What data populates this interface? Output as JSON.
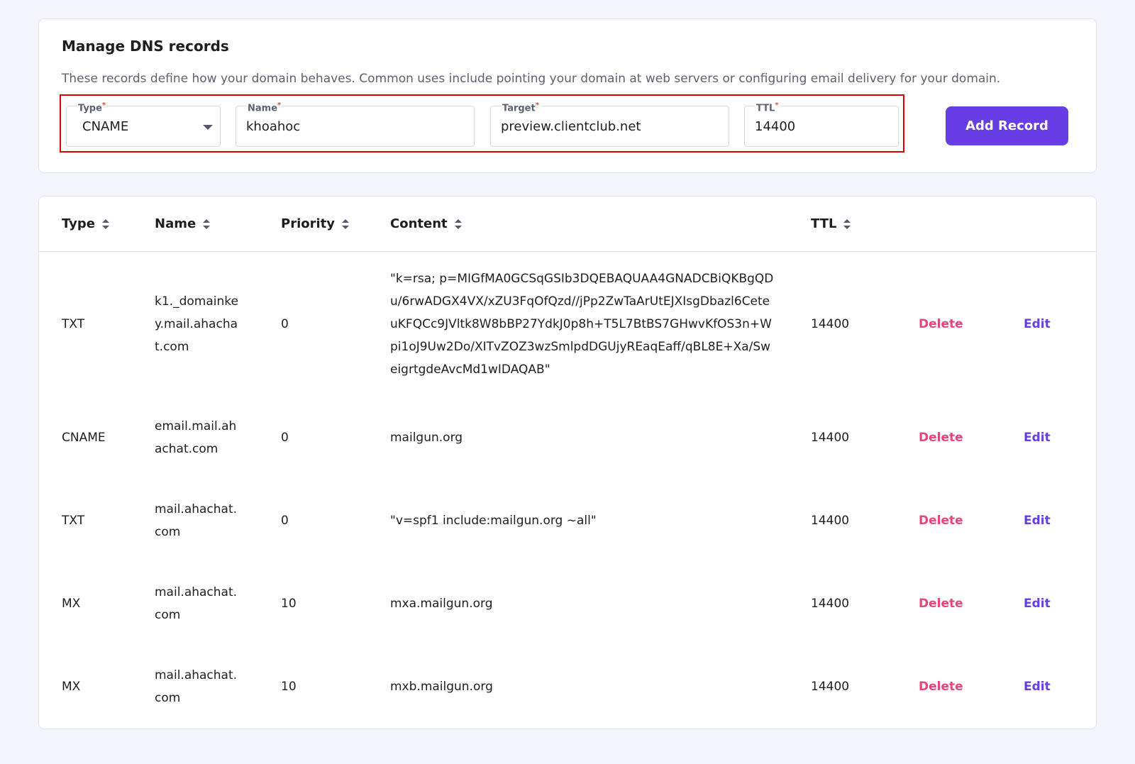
{
  "manage": {
    "title": "Manage DNS records",
    "description": "These records define how your domain behaves. Common uses include pointing your domain at web servers or configuring email delivery for your domain.",
    "form": {
      "type_label": "Type",
      "type_value": "CNAME",
      "name_label": "Name",
      "name_value": "khoahoc",
      "target_label": "Target",
      "target_value": "preview.clientclub.net",
      "ttl_label": "TTL",
      "ttl_value": "14400",
      "required_mark": "*",
      "add_button": "Add Record"
    }
  },
  "table": {
    "headers": {
      "type": "Type",
      "name": "Name",
      "priority": "Priority",
      "content": "Content",
      "ttl": "TTL"
    },
    "actions": {
      "delete": "Delete",
      "edit": "Edit"
    },
    "rows": [
      {
        "type": "TXT",
        "name": "k1._domainkey.mail.ahachat.com",
        "priority": "0",
        "content": "\"k=rsa; p=MIGfMA0GCSqGSIb3DQEBAQUAA4GNADCBiQKBgQDu/6rwADGX4VX/xZU3FqOfQzd//jPp2ZwTaArUtEJXIsgDbazl6CeteuKFQCc9JVltk8W8bBP27YdkJ0p8h+T5L7BtBS7GHwvKfOS3n+Wpi1oJ9Uw2Do/XITvZOZ3wzSmlpdDGUjyREaqEaff/qBL8E+Xa/SweigrtgdeAvcMd1wIDAQAB\"",
        "ttl": "14400"
      },
      {
        "type": "CNAME",
        "name": "email.mail.ahachat.com",
        "priority": "0",
        "content": "mailgun.org",
        "ttl": "14400"
      },
      {
        "type": "TXT",
        "name": "mail.ahachat.com",
        "priority": "0",
        "content": "\"v=spf1 include:mailgun.org ~all\"",
        "ttl": "14400"
      },
      {
        "type": "MX",
        "name": "mail.ahachat.com",
        "priority": "10",
        "content": "mxa.mailgun.org",
        "ttl": "14400"
      },
      {
        "type": "MX",
        "name": "mail.ahachat.com",
        "priority": "10",
        "content": "mxb.mailgun.org",
        "ttl": "14400"
      }
    ]
  }
}
